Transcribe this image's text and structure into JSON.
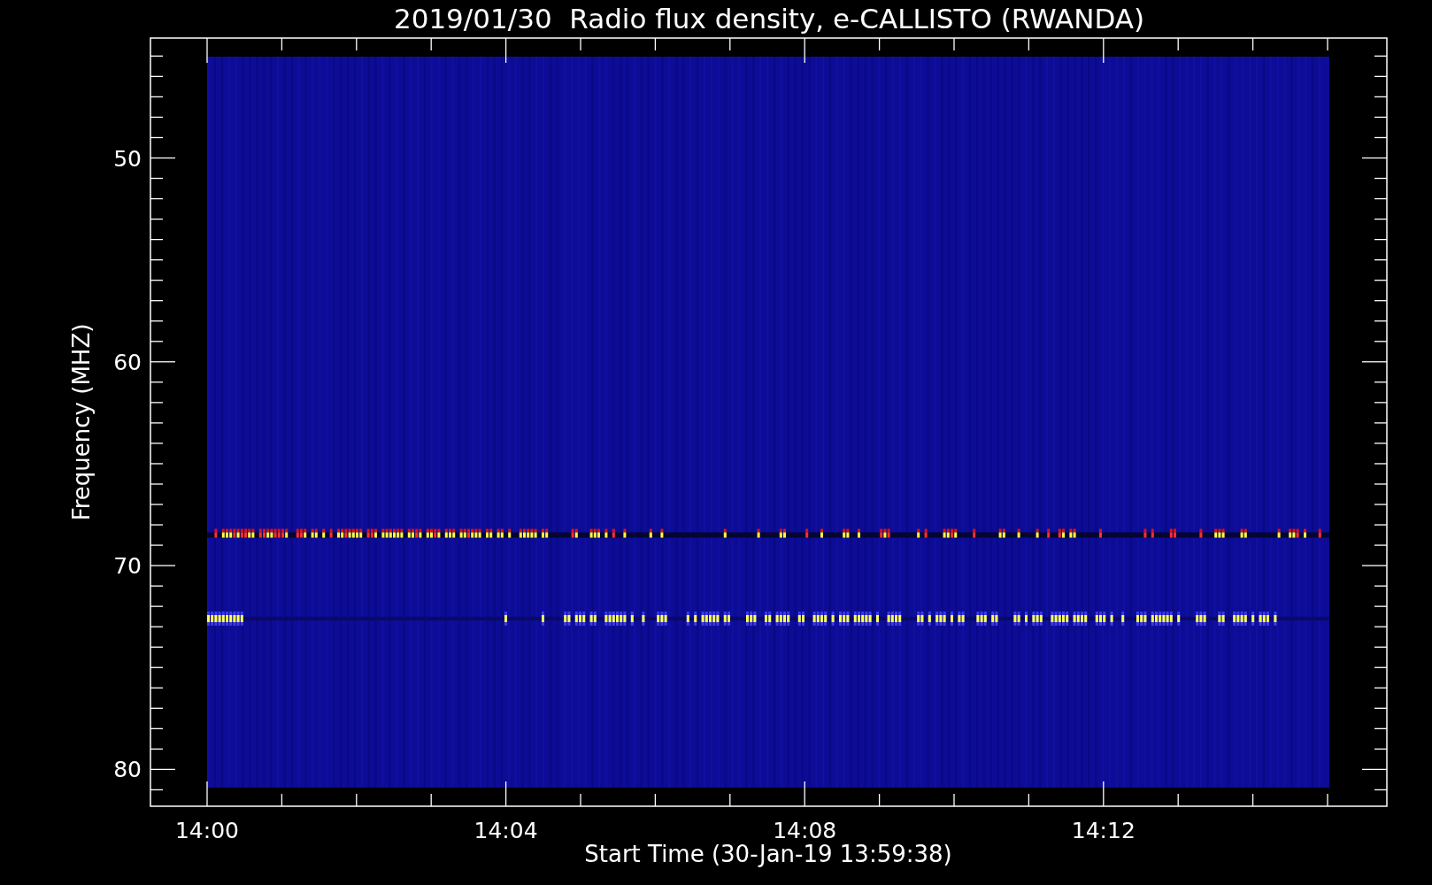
{
  "title": "2019/01/30  Radio flux density, e-CALLISTO (RWANDA)",
  "x_axis": {
    "label": "Start Time (30-Jan-19 13:59:38)",
    "ticks": [
      "14:00",
      "14:04",
      "14:08",
      "14:12"
    ]
  },
  "y_axis": {
    "label": "Frequency (MHZ)",
    "ticks": [
      "50",
      "60",
      "70",
      "80"
    ]
  }
}
